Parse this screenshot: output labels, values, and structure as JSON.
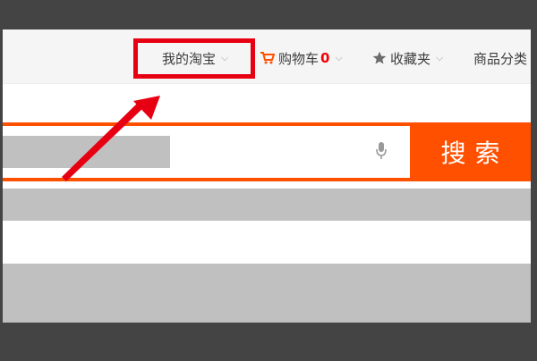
{
  "topnav": {
    "my_taobao": "我的淘宝",
    "cart_label": "购物车",
    "cart_count": "0",
    "favorites": "收藏夹",
    "categories": "商品分类"
  },
  "search": {
    "query": "",
    "button_label": "搜索"
  },
  "colors": {
    "accent": "#ff5000",
    "annotation": "#e60012",
    "cart_count": "#f40000",
    "frame": "#444444",
    "placeholder_gray": "#c0c0c0"
  },
  "icons": {
    "cart": "cart-icon",
    "favorites": "star-icon",
    "voice": "microphone-icon",
    "annotation": "red-arrow-icon"
  }
}
